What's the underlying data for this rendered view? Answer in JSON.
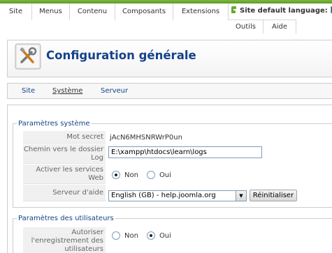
{
  "menu": {
    "items": [
      {
        "label": "Site"
      },
      {
        "label": "Menus"
      },
      {
        "label": "Contenu"
      },
      {
        "label": "Composants"
      },
      {
        "label": "Extensions"
      }
    ],
    "sub_items": [
      {
        "label": "Outils"
      },
      {
        "label": "Aide"
      }
    ],
    "language_label": "Site default language:",
    "language_icon": "leaf-icon",
    "flag_icon": "flag-fr-icon"
  },
  "header": {
    "title": "Configuration générale",
    "icon": "config-tools-icon"
  },
  "tabs": [
    {
      "label": "Site",
      "active": false
    },
    {
      "label": "Système",
      "active": true
    },
    {
      "label": "Serveur",
      "active": false
    }
  ],
  "system_section": {
    "legend": "Paramètres système",
    "secret_label": "Mot secret",
    "secret_value": "jAcN6MHSNRWrP0un",
    "log_label": "Chemin vers le dossier Log",
    "log_value": "E:\\xampp\\htdocs\\learn\\logs",
    "webservices_label": "Activer les services Web",
    "webservices_options": [
      {
        "label": "Non",
        "checked": true
      },
      {
        "label": "Oui",
        "checked": false
      }
    ],
    "help_label": "Serveur d'aide",
    "help_selected": "English (GB) - help.joomla.org",
    "reset_button": "Réinitialiser"
  },
  "users_section": {
    "legend": "Paramètres des utilisateurs",
    "registration_label": "Autoriser l'enregistrement des utilisateurs",
    "registration_options": [
      {
        "label": "Non",
        "checked": false
      },
      {
        "label": "Oui",
        "checked": true
      }
    ]
  },
  "colors": {
    "accent": "#15428b",
    "topbar_green": "#6aa82f",
    "label_bg": "#f0f0f0"
  }
}
